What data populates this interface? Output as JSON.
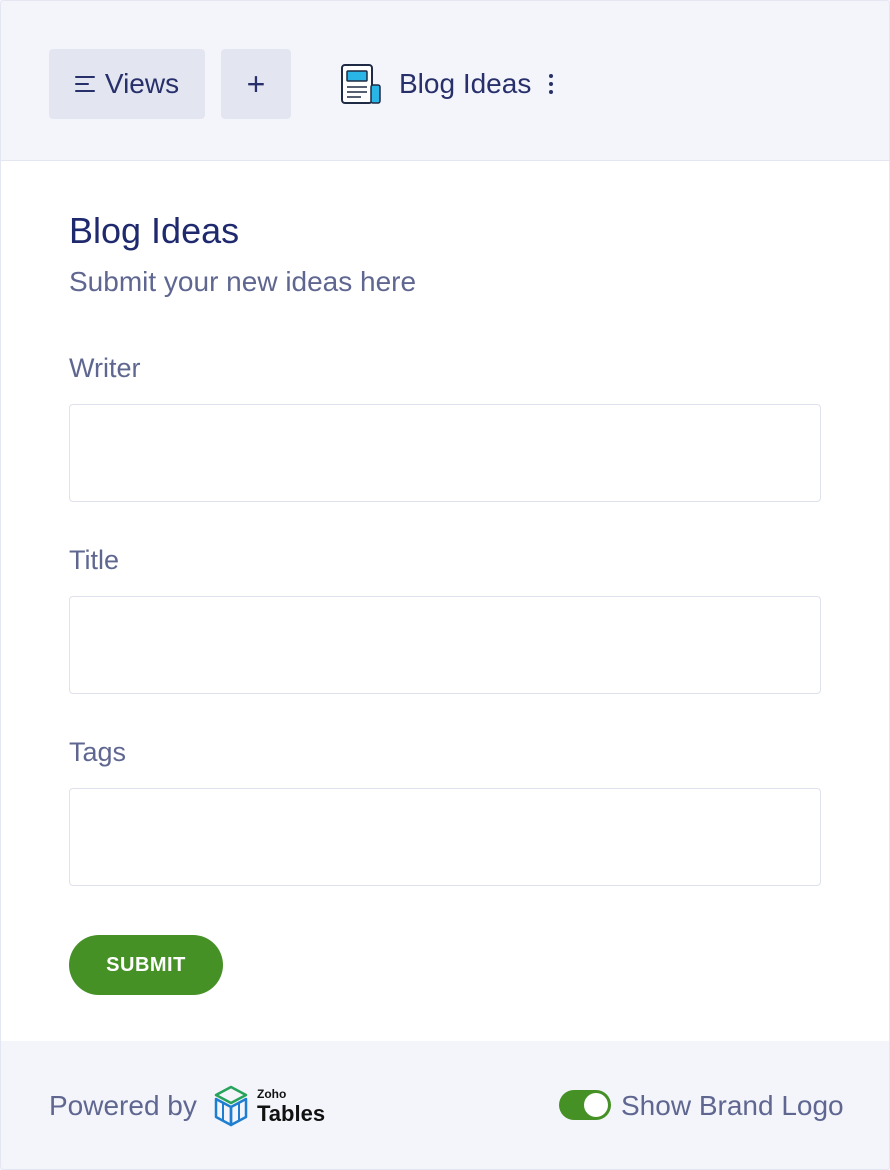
{
  "header": {
    "views_label": "Views",
    "add_label": "+",
    "form_name": "Blog Ideas"
  },
  "form": {
    "title": "Blog Ideas",
    "subtitle": "Submit your new ideas here",
    "fields": [
      {
        "label": "Writer",
        "value": ""
      },
      {
        "label": "Title",
        "value": ""
      },
      {
        "label": "Tags",
        "value": ""
      }
    ],
    "submit_label": "SUBMIT"
  },
  "footer": {
    "powered_by": "Powered by",
    "brand_small": "Zoho",
    "brand_big": "Tables",
    "toggle_label": "Show Brand Logo",
    "toggle_on": true
  },
  "colors": {
    "accent_green": "#469126",
    "text_navy": "#1f2a6e",
    "text_muted": "#5f6791",
    "header_bg": "#f4f5fb",
    "button_bg": "#e3e6f1"
  }
}
